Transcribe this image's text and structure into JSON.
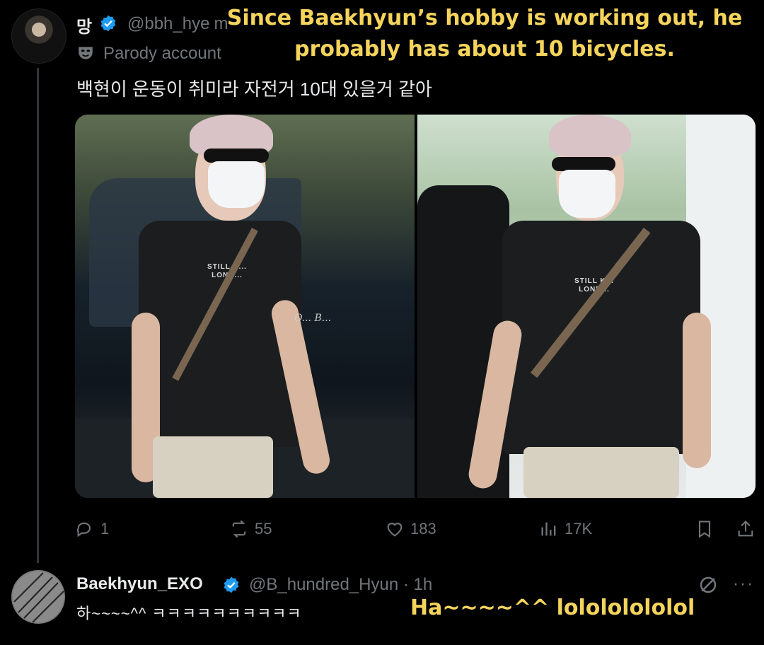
{
  "caption_overlay": "Since Baekhyun’s hobby is working out, he probably has about 10 bicycles.",
  "tweet": {
    "display_name": "망",
    "handle": "@bbh_hye",
    "handle_suffix": "m",
    "parody_label": "Parody account",
    "text": "백현이 운동이 취미라 자전거 10대 있을거 같아",
    "more": "···",
    "photo_left_watermark": "O... B...",
    "actions": {
      "replies": "1",
      "reposts": "55",
      "likes": "183",
      "views": "17K"
    },
    "shirt_print": "STILL K... LOND..."
  },
  "reply": {
    "display_name": "Baekhyun_EXO",
    "handle": "@B_hundred_Hyun",
    "time": "· 1h",
    "text": "하~~~~^^ ㅋㅋㅋㅋㅋㅋㅋㅋㅋㅋ",
    "translation": "Ha~~~~^^ lolololololol",
    "more": "···"
  },
  "colors": {
    "background": "#000000",
    "text": "#e7e9ea",
    "muted": "#71767b",
    "verified": "#1d9bf0",
    "caption_yellow": "#f5d45c"
  }
}
